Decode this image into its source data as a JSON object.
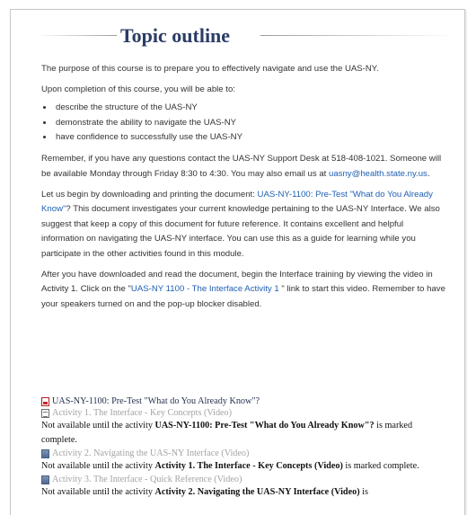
{
  "header": {
    "title": "Topic outline"
  },
  "intro": {
    "purpose": "The purpose of this course is to prepare you to effectively navigate and use the UAS-NY.",
    "upon_completion": "Upon completion of this course, you will be able to:",
    "objectives": [
      "describe the structure of the UAS-NY",
      "demonstrate the ability to navigate the UAS-NY",
      "have confidence to successfully use the UAS-NY"
    ],
    "remember": "Remember, if you have any questions contact the UAS-NY Support Desk at 518-408-1021. Someone will be available Monday through Friday 8:30 to 4:30. You may also email us at",
    "email": "uasny@health.state.ny.us",
    "email_end": ".",
    "letus_start": "Let us begin by downloading and printing the document: ",
    "letus_link": "UAS-NY-1100: Pre-Test \"What do You Already Know\"",
    "letus_end": "? This document investigates your current knowledge pertaining to the UAS-NY Interface.  We also suggest that keep a copy of this document for future reference.  It contains excellent and helpful information on navigating the UAS-NY interface.  You can use this as a guide for learning while you participate in the other activities found in this module.",
    "after_start": "After you have downloaded and read the document, begin the Interface training by viewing the video in Activity 1. Click on the \"",
    "after_link": "UAS-NY 1100 - The Interface Activity 1",
    "after_end": " \" link to start this video. Remember to have your speakers turned on and the pop-up blocker disabled."
  },
  "activities": {
    "pretest_label": "UAS-NY-1100: Pre-Test \"What do You Already Know\"?",
    "a1_label": "Activity 1. The Interface - Key Concepts (Video)",
    "a1_restrict_pre": "Not available until the activity ",
    "a1_restrict_name": "UAS-NY-1100: Pre-Test \"What do You Already Know\"?",
    "a1_restrict_post": " is marked complete.",
    "a2_label": "Activity 2. Navigating the UAS-NY Interface (Video)",
    "a2_restrict_pre": "Not available until the activity ",
    "a2_restrict_name": "Activity 1. The Interface - Key Concepts (Video)",
    "a2_restrict_post": " is marked complete.",
    "a3_label": "Activity 3. The Interface - Quick Reference (Video)",
    "a3_restrict_pre": "Not available until the activity ",
    "a3_restrict_name": "Activity 2. Navigating the UAS-NY Interface (Video)",
    "a3_restrict_post": " is"
  },
  "icons": {
    "pretest": "pdf-icon",
    "a1": "document-icon",
    "a2": "video-icon",
    "a3": "video-icon"
  },
  "colors": {
    "title": "#2b3c66",
    "link": "#1f5fb3",
    "body_text": "#333333",
    "dim_text": "#a3a3a3"
  }
}
